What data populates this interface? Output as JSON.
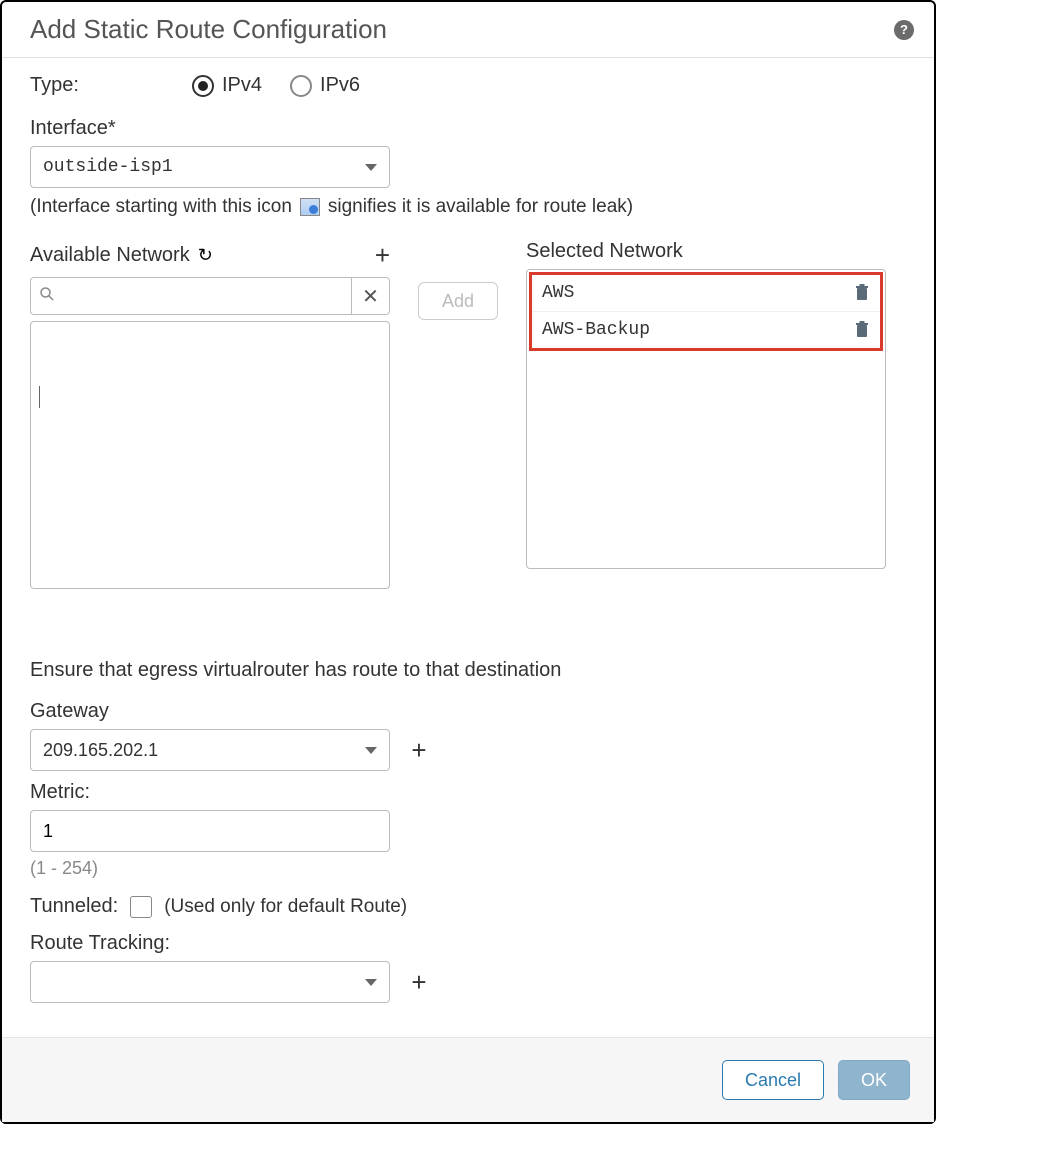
{
  "dialog": {
    "title": "Add Static Route Configuration"
  },
  "type": {
    "label": "Type:",
    "ipv4": "IPv4",
    "ipv6": "IPv6",
    "selected": "IPv4"
  },
  "interface": {
    "label": "Interface*",
    "value": "outside-isp1",
    "hint_pre": "(Interface starting with this icon",
    "hint_post": "signifies it is available for route leak)"
  },
  "available": {
    "label": "Available Network",
    "search_value": "",
    "add_label": "Add",
    "items": []
  },
  "selected": {
    "label": "Selected Network",
    "items": [
      "AWS",
      "AWS-Backup"
    ]
  },
  "egress_note": "Ensure that egress virtualrouter has route to that destination",
  "gateway": {
    "label": "Gateway",
    "value": "209.165.202.1"
  },
  "metric": {
    "label": "Metric:",
    "value": "1",
    "range": "(1 - 254)"
  },
  "tunneled": {
    "label": "Tunneled:",
    "checked": false,
    "hint": "(Used only for default Route)"
  },
  "route_tracking": {
    "label": "Route Tracking:",
    "value": ""
  },
  "footer": {
    "cancel": "Cancel",
    "ok": "OK"
  }
}
